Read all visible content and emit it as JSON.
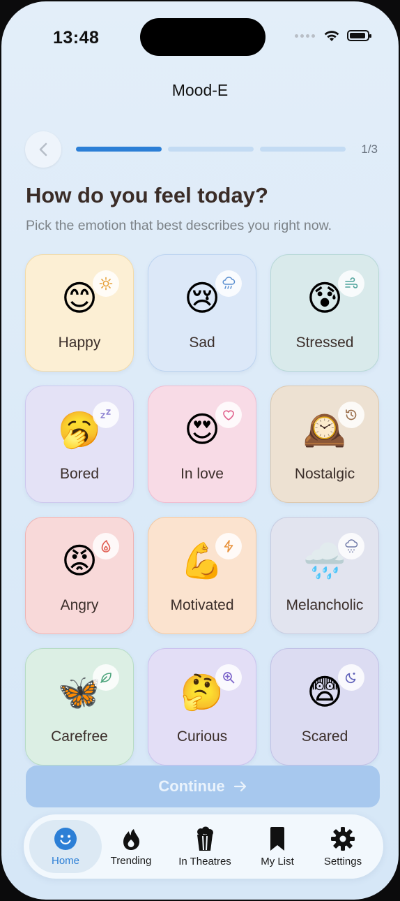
{
  "status_bar": {
    "time": "13:48"
  },
  "app": {
    "title": "Mood-E"
  },
  "progress": {
    "step_label": "1/3",
    "total_steps": 3,
    "current_step": 1
  },
  "question": {
    "title": "How do you feel today?",
    "subtitle": "Pick the emotion that best describes you right now."
  },
  "moods": [
    {
      "label": "Happy",
      "emoji": "😊",
      "badge_icon": "sun-icon"
    },
    {
      "label": "Sad",
      "emoji": "😢",
      "badge_icon": "rain-cloud-icon"
    },
    {
      "label": "Stressed",
      "emoji": "😰",
      "badge_icon": "wind-icon"
    },
    {
      "label": "Bored",
      "emoji": "🥱",
      "badge_icon": "zzz-icon"
    },
    {
      "label": "In love",
      "emoji": "😍",
      "badge_icon": "heart-icon"
    },
    {
      "label": "Nostalgic",
      "emoji": "🕰️",
      "badge_icon": "history-icon"
    },
    {
      "label": "Angry",
      "emoji": "😡",
      "badge_icon": "flame-icon"
    },
    {
      "label": "Motivated",
      "emoji": "💪",
      "badge_icon": "lightning-icon"
    },
    {
      "label": "Melancholic",
      "emoji": "🌧️",
      "badge_icon": "snow-cloud-icon"
    },
    {
      "label": "Carefree",
      "emoji": "🦋",
      "badge_icon": "leaf-icon"
    },
    {
      "label": "Curious",
      "emoji": "🤔",
      "badge_icon": "zoom-in-icon"
    },
    {
      "label": "Scared",
      "emoji": "😨",
      "badge_icon": "moon-stars-icon"
    }
  ],
  "continue_button": {
    "label": "Continue"
  },
  "tabs": [
    {
      "label": "Home",
      "icon": "smiley-icon"
    },
    {
      "label": "Trending",
      "icon": "flame-icon"
    },
    {
      "label": "In Theatres",
      "icon": "popcorn-icon"
    },
    {
      "label": "My List",
      "icon": "bookmark-icon"
    },
    {
      "label": "Settings",
      "icon": "gear-icon"
    }
  ],
  "colors": {
    "accent": "#2c7fd6",
    "continue_disabled": "#a7c8ee",
    "heading": "#3a2c27"
  }
}
